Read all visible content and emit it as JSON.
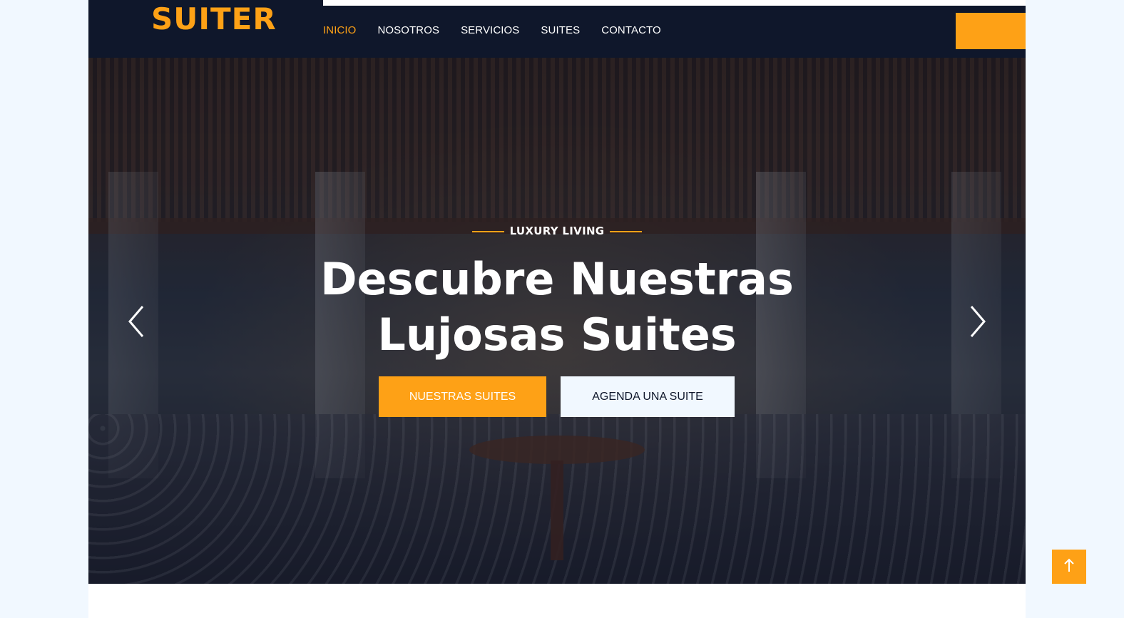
{
  "brand": {
    "logo": "SUITER",
    "accent": "#fea116",
    "dark": "#0f172b"
  },
  "nav": {
    "items": [
      {
        "label": "INICIO",
        "active": true
      },
      {
        "label": "NOSOTROS",
        "active": false
      },
      {
        "label": "SERVICIOS",
        "active": false
      },
      {
        "label": "SUITES",
        "active": false
      },
      {
        "label": "CONTACTO",
        "active": false
      }
    ]
  },
  "hero": {
    "eyebrow": "LUXURY LIVING",
    "headline_line1": "Descubre Nuestras",
    "headline_line2": "Lujosas Suites",
    "primary_button": "NUESTRAS SUITES",
    "secondary_button": "AGENDA UNA SUITE",
    "prev_icon": "chevron-left-icon",
    "next_icon": "chevron-right-icon"
  },
  "back_to_top": {
    "icon": "arrow-up-icon"
  }
}
